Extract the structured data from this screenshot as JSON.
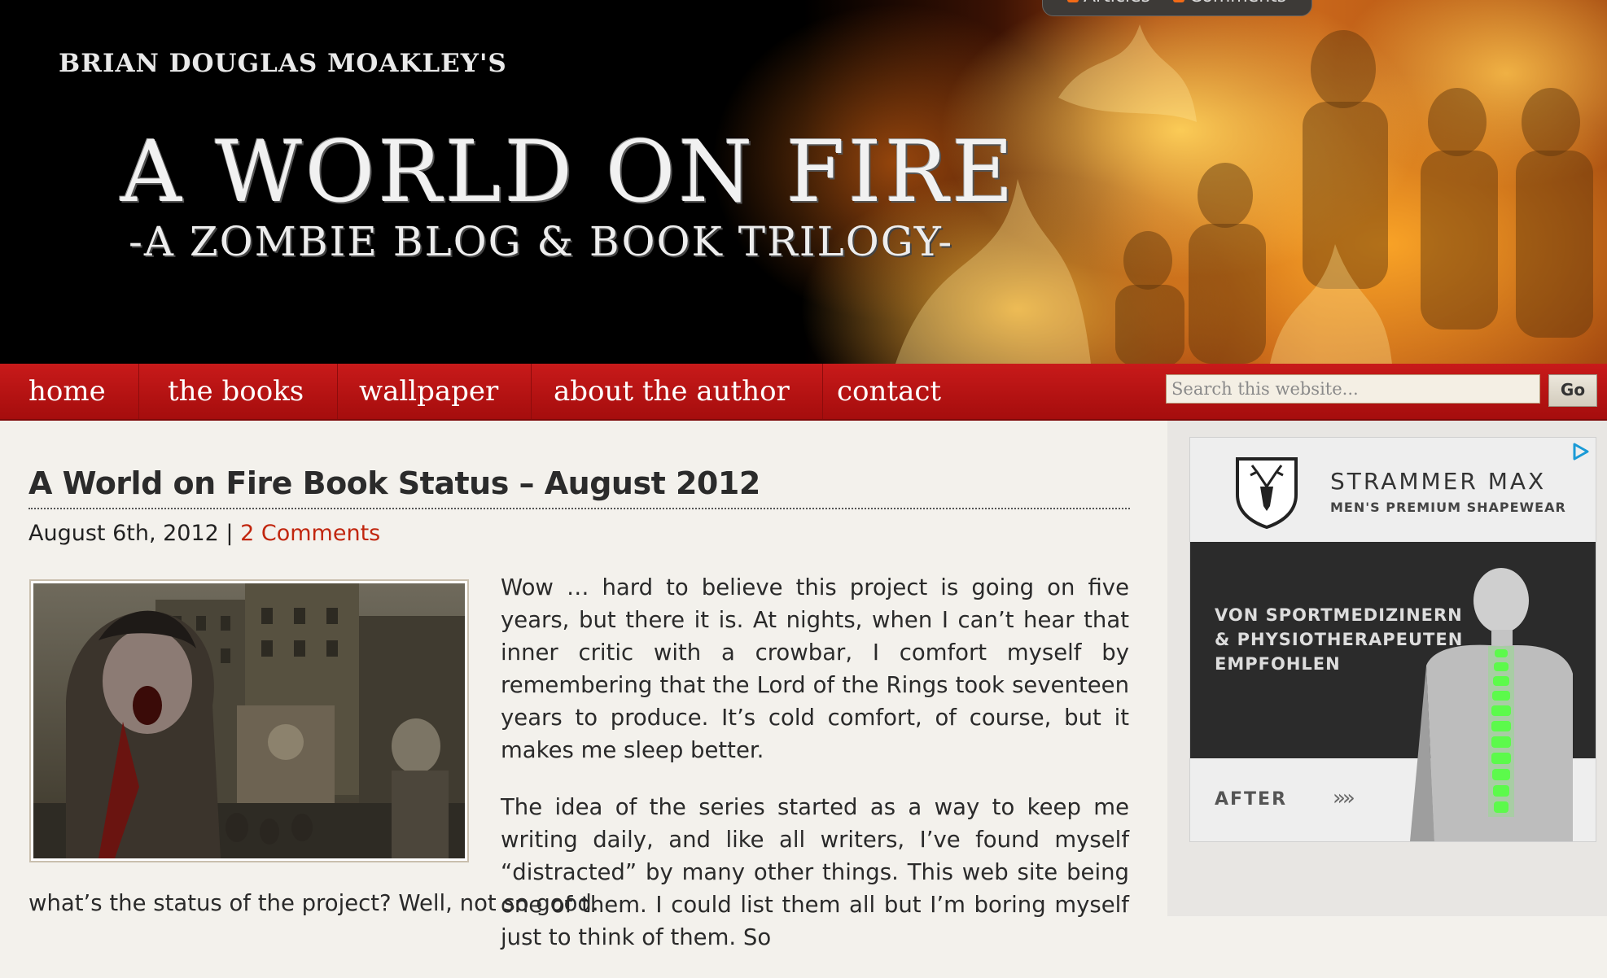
{
  "header": {
    "author": "BRIAN DOUGLAS MOAKLEY'S",
    "title": "A WORLD ON FIRE",
    "subtitle": "-A ZOMBIE BLOG & BOOK TRILOGY-",
    "feeds": [
      "Articles",
      "Comments"
    ]
  },
  "nav": {
    "items": [
      "home",
      "the books",
      "wallpaper",
      "about the author",
      "contact"
    ]
  },
  "search": {
    "placeholder": "Search this website...",
    "button": "Go"
  },
  "post": {
    "title": "A World on Fire Book Status – August 2012",
    "date": "August 6th, 2012",
    "separator": "|",
    "comments": "2 Comments",
    "paragraphs": [
      "Wow … hard to believe this project is going on five years, but there it is. At nights, when I can’t hear that inner critic with a crowbar, I comfort myself by remembering that the Lord of the Rings took seventeen years to produce. It’s cold comfort, of course, but it makes me sleep better.",
      "The idea of the series started as a way to keep me writing daily, and like all writers, I’ve found myself “distracted” by many other things. This web site being one of them. I could list them all but I’m boring myself just to think of them. So"
    ],
    "tail": "what’s the status of the project? Well, not so good."
  },
  "ad": {
    "brand": "STRAMMER MAX",
    "tagline": "MEN'S PREMIUM SHAPEWEAR",
    "claim_lines": [
      "VON SPORTMEDIZINERN",
      "& PHYSIOTHERAPEUTEN",
      "EMPFOHLEN"
    ],
    "after": "AFTER",
    "arrows": "»»",
    "logo_icon": "deer-crest-icon",
    "adchoices_icon": "adchoices-icon"
  },
  "colors": {
    "nav_red": "#b31212",
    "link_red": "#c1260e",
    "page_bg": "#f3f1ec"
  }
}
